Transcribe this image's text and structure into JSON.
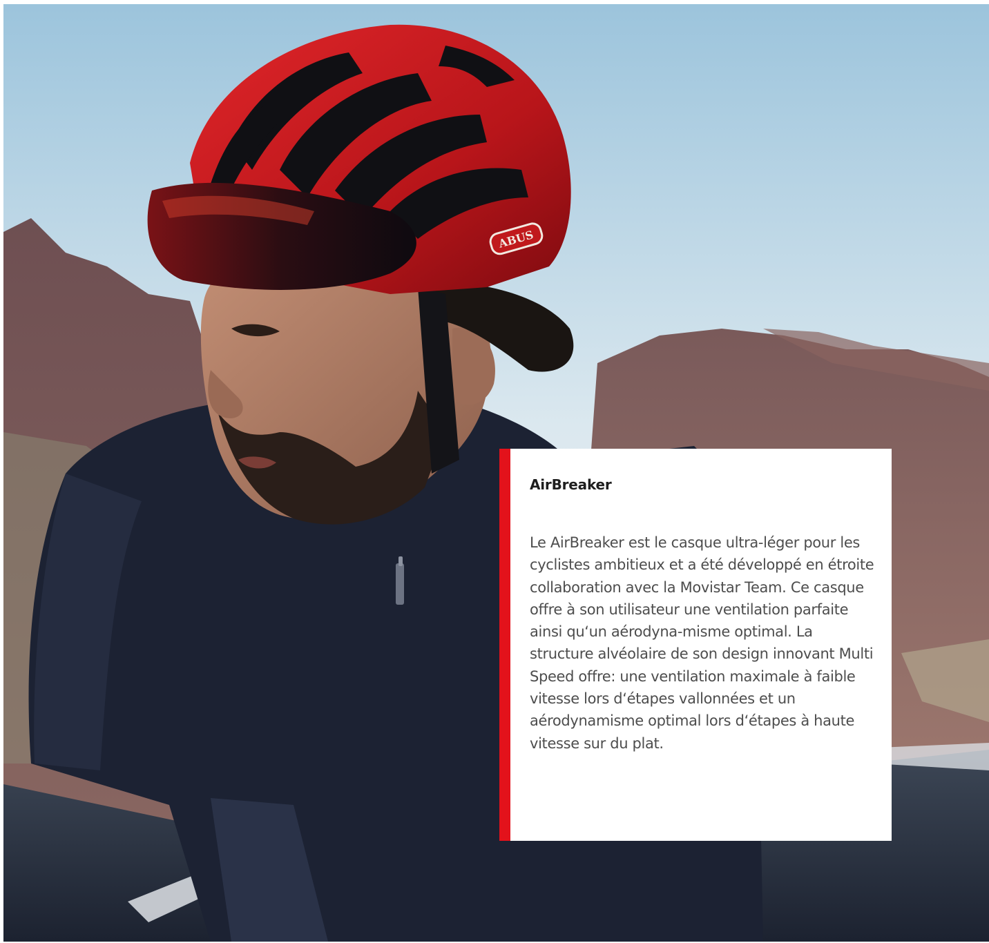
{
  "photo": {
    "helmet_brand": "ABUS",
    "colors": {
      "sky_top": "#9cc4dc",
      "sky_bottom": "#f0f4f6",
      "mountain": "#7d5c5a",
      "helmet": "#c0191c",
      "jersey": "#1c2233",
      "skin": "#a87660",
      "hair": "#1a1512"
    }
  },
  "card": {
    "title": "AirBreaker",
    "body": "Le AirBreaker est le casque ultra-léger pour les cyclistes ambitieux et a été développé en étroite collaboration avec la Movistar Team. Ce casque offre à son utilisateur une ventilation parfaite ainsi qu‘un aérodyna-misme optimal. La structure alvéolaire de son design innovant Multi Speed offre: une ventilation maximale à faible vitesse lors d‘étapes vallonnées et un aérodynamisme optimal lors d‘étapes à haute vitesse sur du plat.",
    "accent_color": "#e3121b"
  }
}
